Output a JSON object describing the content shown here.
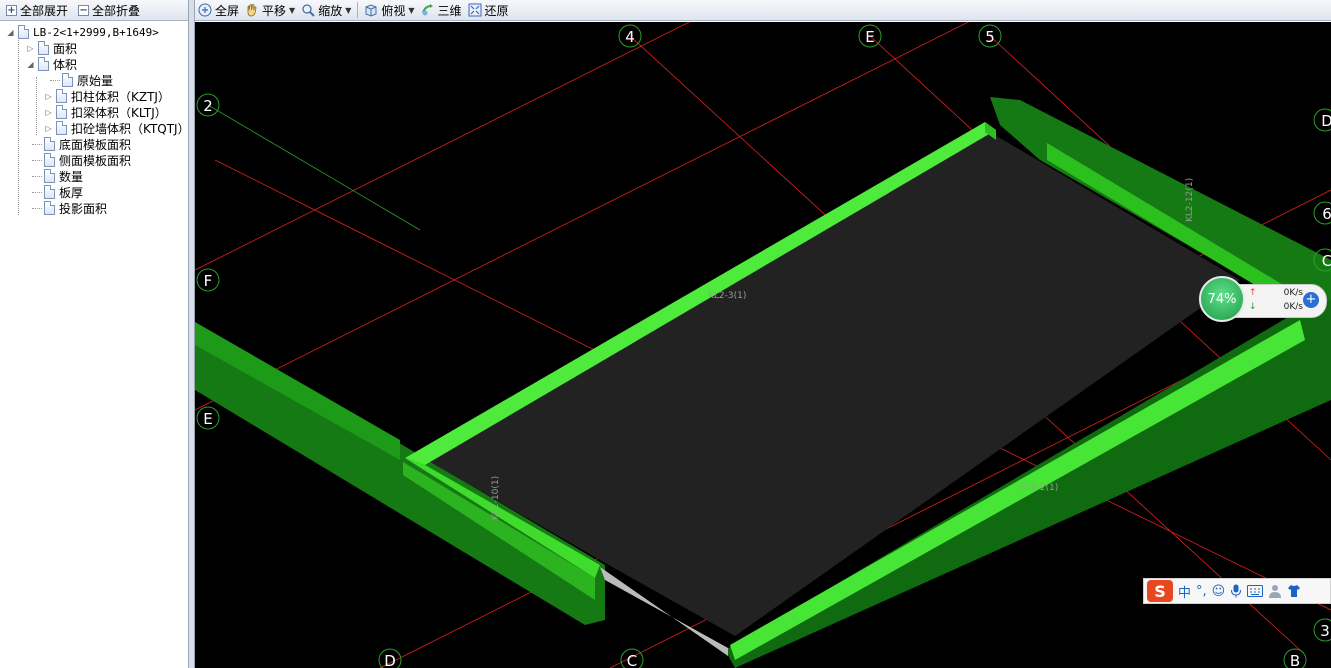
{
  "left_toolbar": {
    "expand_all": "全部展开",
    "collapse_all": "全部折叠"
  },
  "tree": {
    "root": "LB-2<1+2999,B+1649>",
    "items": [
      "面积",
      "体积",
      "原始量",
      "扣柱体积（KZTJ）",
      "扣梁体积（KLTJ）",
      "扣砼墙体积（KTQTJ）",
      "底面模板面积",
      "侧面模板面积",
      "数量",
      "板厚",
      "投影面积"
    ]
  },
  "main_toolbar": {
    "fullscreen": "全屏",
    "pan": "平移",
    "zoom": "缩放",
    "top_view": "俯视",
    "three_d": "三维",
    "restore": "还原"
  },
  "axis_labels": {
    "a4": "4",
    "aE_top": "E",
    "a5": "5",
    "aD_right": "D",
    "a6": "6",
    "aC_right": "C",
    "a2": "2",
    "aF": "F",
    "aE_left": "E",
    "aD_bottom": "D",
    "aC_bottom": "C",
    "a3": "3",
    "aB": "B"
  },
  "beam_labels": {
    "top": "KL2-3(1)",
    "right": "KL2-12(1)",
    "left": "KL2-10(1)",
    "bottom": "KL2-2(1)"
  },
  "net_widget": {
    "percent": "74%",
    "upload": "0K/s",
    "download": "0K/s"
  },
  "ime": {
    "mode": "中",
    "punct": "°,"
  },
  "colors": {
    "viewport_bg": "#000000",
    "grid_line": "#e02020",
    "beam": "#22c41c",
    "slab": "#222222"
  }
}
